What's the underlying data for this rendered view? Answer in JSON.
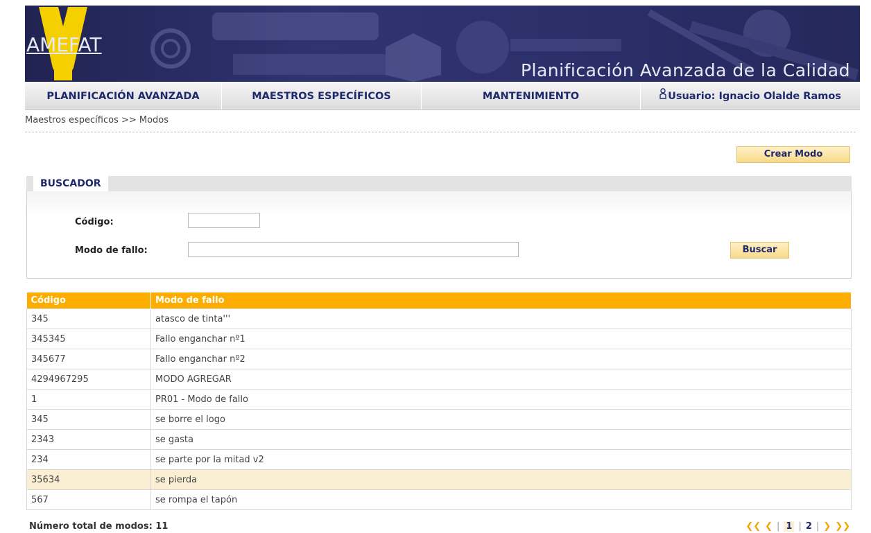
{
  "banner": {
    "logo_text": "AMEFAT",
    "title": "Planificación Avanzada de la Calidad"
  },
  "nav": [
    {
      "label": "PLANIFICACIÓN AVANZADA"
    },
    {
      "label": "MAESTROS ESPECÍFICOS"
    },
    {
      "label": "MANTENIMIENTO"
    },
    {
      "label": "Usuario: Ignacio Olalde Ramos",
      "icon": "user-icon"
    }
  ],
  "breadcrumb": "Maestros específicos >> Modos",
  "create_button": "Crear Modo",
  "search": {
    "title": "BUSCADOR",
    "code_label": "Código:",
    "code_value": "",
    "mode_label": "Modo de fallo:",
    "mode_value": "",
    "button": "Buscar"
  },
  "table": {
    "headers": [
      "Código",
      "Modo de fallo"
    ],
    "rows": [
      [
        "345",
        "atasco de tinta'''"
      ],
      [
        "345345",
        "Fallo enganchar nº1"
      ],
      [
        "345677",
        "Fallo enganchar nº2"
      ],
      [
        "4294967295",
        "MODO AGREGAR"
      ],
      [
        "1",
        "PR01 - Modo de fallo"
      ],
      [
        "345",
        "se borre el logo"
      ],
      [
        "2343",
        "se gasta"
      ],
      [
        "234",
        "se parte por la mitad v2"
      ],
      [
        "35634",
        "se pierda"
      ],
      [
        "567",
        "se rompa el tapón"
      ]
    ],
    "highlight_row": 8
  },
  "footer": {
    "total": "Número total de modos: 11",
    "pager": {
      "first": "«",
      "prev": "‹",
      "pages": [
        "1",
        "2"
      ],
      "current": "1",
      "next": "›",
      "last": "»"
    }
  },
  "colors": {
    "accent": "#fcad00",
    "nav_text": "#1f2a6e",
    "banner": "#2a2d66"
  }
}
